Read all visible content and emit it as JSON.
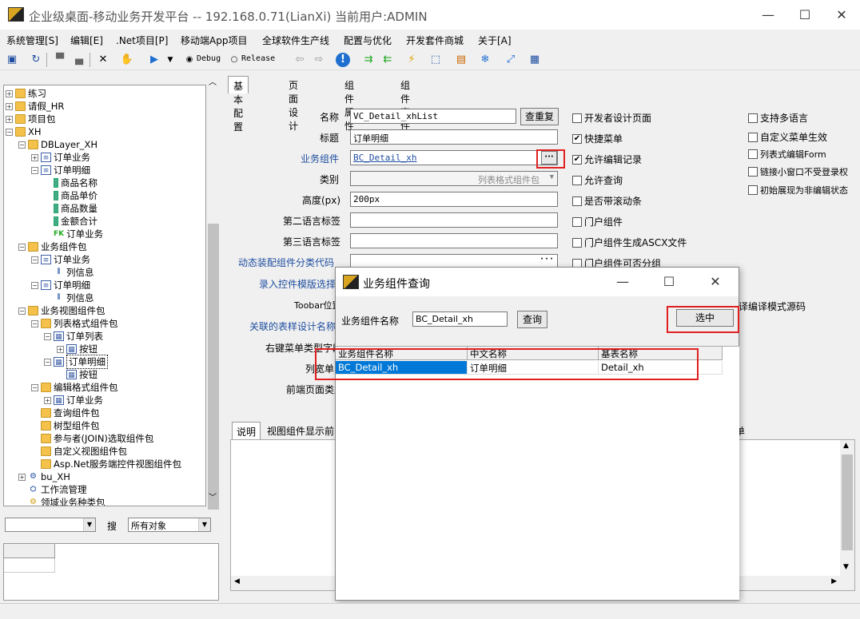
{
  "window": {
    "title": "企业级桌面-移动业务开发平台 -- 192.168.0.71(LianXi) 当前用户:ADMIN",
    "minimize": "—",
    "maximize": "☐",
    "close": "✕"
  },
  "menu": [
    "系统管理[S]",
    "编辑[E]",
    ".Net项目[P]",
    "移动端App项目",
    "全球软件生产线",
    "配置与优化",
    "开发套件商城",
    "关于[A]"
  ],
  "toolbar": {
    "debug_label": "Debug",
    "release_label": "Release"
  },
  "tree": {
    "nodes": [
      "练习",
      "请假_HR",
      "项目包",
      "XH",
      "DBLayer_XH",
      "订单业务",
      "订单明细",
      "商品名称",
      "商品单价",
      "商品数量",
      "金额合计",
      "订单业务",
      "业务组件包",
      "订单业务",
      "列信息",
      "订单明细",
      "列信息",
      "业务视图组件包",
      "列表格式组件包",
      "订单列表",
      "按钮",
      "订单明细",
      "按钮",
      "编辑格式组件包",
      "订单业务",
      "查询组件包",
      "树型组件包",
      "参与者(JOIN)选取组件包",
      "自定义视图组件包",
      "Asp.Net服务端控件视图组件包",
      "bu_XH",
      "工作流管理",
      "领域业务种类包"
    ],
    "fk_badge": "FK"
  },
  "search": {
    "label": "搜",
    "combo1_value": "",
    "combo2_value": "所有对象"
  },
  "tabs": [
    "基本配置",
    "页面设计",
    "组件属性",
    "组件事件"
  ],
  "form": {
    "name_label": "名称",
    "name_value": "VC_Detail_xhList",
    "reset_button": "查重复",
    "title_label": "标题",
    "title_value": "订单明细",
    "component_label": "业务组件",
    "component_value": "BC_Detail_xh",
    "ellipsis": "···",
    "category_label": "类别",
    "category_value": "列表格式组件包",
    "height_label": "高度(px)",
    "height_value": "200px",
    "lang2_label": "第二语言标签",
    "lang3_label": "第三语言标签",
    "dyn_label": "动态装配组件分类代码",
    "input_label": "录入控件模版选择",
    "toolbar_label": "Toobar位置",
    "related_label": "关联的表样设计名称",
    "rightmenu_label": "右键菜单类型字段",
    "listview_label": "列宽单",
    "front_label": "前端页面类型"
  },
  "checks_mid": [
    {
      "label": "开发者设计页面",
      "checked": false
    },
    {
      "label": "快捷菜单",
      "checked": true
    },
    {
      "label": "允许编辑记录",
      "checked": true
    },
    {
      "label": "允许查询",
      "checked": false
    },
    {
      "label": "是否带滚动条",
      "checked": false
    },
    {
      "label": "门户组件",
      "checked": false
    },
    {
      "label": "门户组件生成ASCX文件",
      "checked": false
    },
    {
      "label": "门户组件可否分组",
      "checked": false
    }
  ],
  "checks_right": [
    {
      "label": "支持多语言",
      "checked": false
    },
    {
      "label": "自定义菜单生效",
      "checked": false
    },
    {
      "label": "列表式编辑Form",
      "checked": false
    },
    {
      "label": "链接小窗口不受登录权",
      "checked": false
    },
    {
      "label": "初始展现为非编辑状态",
      "checked": false
    }
  ],
  "partial_right_text": "译编译模式源码",
  "bottom_tabs": [
    "说明",
    "视图组件显示前",
    "单"
  ],
  "dialog": {
    "title": "业务组件查询",
    "search_label": "业务组件名称",
    "search_value": "BC_Detail_xh",
    "query_button": "查询",
    "select_button": "选中",
    "columns": [
      "业务组件名称",
      "中文名称",
      "基表名称"
    ],
    "rows": [
      [
        "BC_Detail_xh",
        "订单明细",
        "Detail_xh"
      ]
    ]
  },
  "colors": {
    "highlight_red": "#e02020",
    "selection_blue": "#0078d7",
    "label_blue": "#1f4ea0"
  }
}
